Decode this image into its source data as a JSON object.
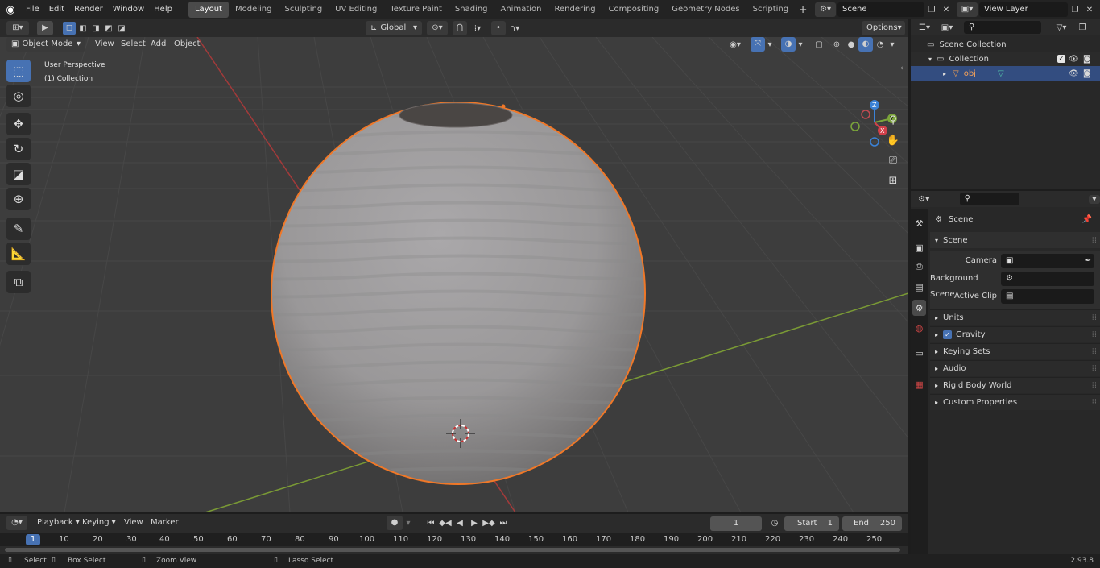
{
  "app": {
    "version": "2.93.8"
  },
  "menu": [
    "File",
    "Edit",
    "Render",
    "Window",
    "Help"
  ],
  "workspaces": [
    "Layout",
    "Modeling",
    "Sculpting",
    "UV Editing",
    "Texture Paint",
    "Shading",
    "Animation",
    "Rendering",
    "Compositing",
    "Geometry Nodes",
    "Scripting"
  ],
  "active_workspace": "Layout",
  "scene_field": "Scene",
  "view_layer_field": "View Layer",
  "top_header": {
    "orientation": "Global",
    "options": "Options"
  },
  "viewport_header": {
    "mode": "Object Mode",
    "menus": [
      "View",
      "Select",
      "Add",
      "Object"
    ]
  },
  "viewport": {
    "perspective_label": "User Perspective",
    "collection_label": "(1) Collection",
    "gizmo": {
      "x": "X",
      "y": "Y",
      "z": "Z"
    },
    "colors": {
      "bg": "#3d3d3d",
      "grid": "#4a4a4a",
      "x_axis": "#a33a3a",
      "y_axis": "#7a9a35",
      "selection": "#f07828",
      "sphere": "#9c9a9b"
    }
  },
  "outliner": {
    "scene_collection": "Scene Collection",
    "collection": "Collection",
    "object": "obj"
  },
  "properties": {
    "context": "Scene",
    "section": "Scene",
    "fields": [
      {
        "label": "Camera"
      },
      {
        "label": "Background Scene"
      },
      {
        "label": "Active Clip"
      }
    ],
    "panels": [
      "Units",
      "Gravity",
      "Keying Sets",
      "Audio",
      "Rigid Body World",
      "Custom Properties"
    ]
  },
  "timeline": {
    "menus": [
      "Playback",
      "Keying",
      "View",
      "Marker"
    ],
    "current_frame": "1",
    "start_label": "Start",
    "start": "1",
    "end_label": "End",
    "end": "250",
    "ruler": [
      "1",
      "10",
      "20",
      "30",
      "40",
      "50",
      "60",
      "70",
      "80",
      "90",
      "100",
      "110",
      "120",
      "130",
      "140",
      "150",
      "160",
      "170",
      "180",
      "190",
      "200",
      "210",
      "220",
      "230",
      "240",
      "250"
    ]
  },
  "statusbar": {
    "select": "Select",
    "box_select": "Box Select",
    "zoom_view": "Zoom View",
    "lasso_select": "Lasso Select"
  }
}
